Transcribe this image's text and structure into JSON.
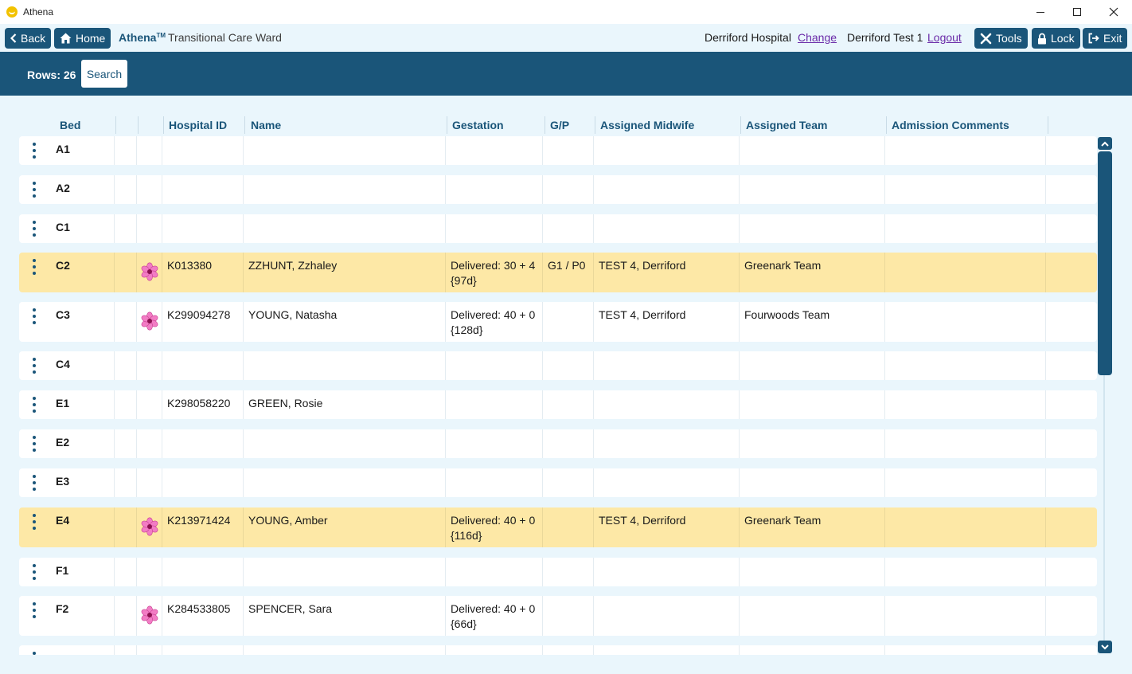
{
  "window": {
    "title": "Athena"
  },
  "toolbar": {
    "back_label": "Back",
    "home_label": "Home",
    "brand": "Athena",
    "brand_tm": "TM",
    "ward": "Transitional Care Ward",
    "hospital": "Derriford Hospital",
    "change_label": "Change",
    "user": "Derriford Test 1",
    "logout_label": "Logout",
    "tools_label": "Tools",
    "lock_label": "Lock",
    "exit_label": "Exit"
  },
  "search": {
    "rows_label": "Rows: 26",
    "search_label": "Search"
  },
  "table": {
    "headers": [
      "Bed",
      "",
      "",
      "Hospital ID",
      "Name",
      "Gestation",
      "G/P",
      "Assigned Midwife",
      "Assigned Team",
      "Admission Comments"
    ],
    "rows": [
      {
        "bed": "A1",
        "flag": false,
        "id": "",
        "name": "",
        "gest1": "",
        "gest2": "",
        "gp": "",
        "midwife": "",
        "team": "",
        "comments": "",
        "highlight": false
      },
      {
        "bed": "A2",
        "flag": false,
        "id": "",
        "name": "",
        "gest1": "",
        "gest2": "",
        "gp": "",
        "midwife": "",
        "team": "",
        "comments": "",
        "highlight": false
      },
      {
        "bed": "C1",
        "flag": false,
        "id": "",
        "name": "",
        "gest1": "",
        "gest2": "",
        "gp": "",
        "midwife": "",
        "team": "",
        "comments": "",
        "highlight": false
      },
      {
        "bed": "C2",
        "flag": true,
        "id": "K013380",
        "name": "ZZHUNT, Zzhaley",
        "gest1": "Delivered: 30 + 4",
        "gest2": "{97d}",
        "gp": "G1 / P0",
        "midwife": "TEST 4, Derriford",
        "team": "Greenark Team",
        "comments": "",
        "highlight": true
      },
      {
        "bed": "C3",
        "flag": true,
        "id": "K299094278",
        "name": "YOUNG, Natasha",
        "gest1": "Delivered: 40 + 0",
        "gest2": "{128d}",
        "gp": "",
        "midwife": "TEST 4, Derriford",
        "team": "Fourwoods Team",
        "comments": "",
        "highlight": false
      },
      {
        "bed": "C4",
        "flag": false,
        "id": "",
        "name": "",
        "gest1": "",
        "gest2": "",
        "gp": "",
        "midwife": "",
        "team": "",
        "comments": "",
        "highlight": false
      },
      {
        "bed": "E1",
        "flag": false,
        "id": "K298058220",
        "name": "GREEN, Rosie",
        "gest1": "",
        "gest2": "",
        "gp": "",
        "midwife": "",
        "team": "",
        "comments": "",
        "highlight": false
      },
      {
        "bed": "E2",
        "flag": false,
        "id": "",
        "name": "",
        "gest1": "",
        "gest2": "",
        "gp": "",
        "midwife": "",
        "team": "",
        "comments": "",
        "highlight": false
      },
      {
        "bed": "E3",
        "flag": false,
        "id": "",
        "name": "",
        "gest1": "",
        "gest2": "",
        "gp": "",
        "midwife": "",
        "team": "",
        "comments": "",
        "highlight": false
      },
      {
        "bed": "E4",
        "flag": true,
        "id": "K213971424",
        "name": "YOUNG, Amber",
        "gest1": "Delivered: 40 + 0",
        "gest2": "{116d}",
        "gp": "",
        "midwife": "TEST 4, Derriford",
        "team": "Greenark Team",
        "comments": "",
        "highlight": true
      },
      {
        "bed": "F1",
        "flag": false,
        "id": "",
        "name": "",
        "gest1": "",
        "gest2": "",
        "gp": "",
        "midwife": "",
        "team": "",
        "comments": "",
        "highlight": false
      },
      {
        "bed": "F2",
        "flag": true,
        "id": "K284533805",
        "name": "SPENCER, Sara",
        "gest1": "Delivered: 40 + 0",
        "gest2": "{66d}",
        "gp": "",
        "midwife": "",
        "team": "",
        "comments": "",
        "highlight": false
      },
      {
        "bed": "",
        "flag": false,
        "id": "",
        "name": "",
        "gest1": "",
        "gest2": "",
        "gp": "",
        "midwife": "",
        "team": "",
        "comments": "",
        "highlight": false
      }
    ]
  },
  "colors": {
    "primary": "#1a5579",
    "highlight_row": "#fde8a6",
    "background": "#eaf6fc",
    "link": "#6a2aa8"
  },
  "icons": {
    "row_menu": "vertical-dots-icon",
    "flag": "pink-flower-icon"
  }
}
